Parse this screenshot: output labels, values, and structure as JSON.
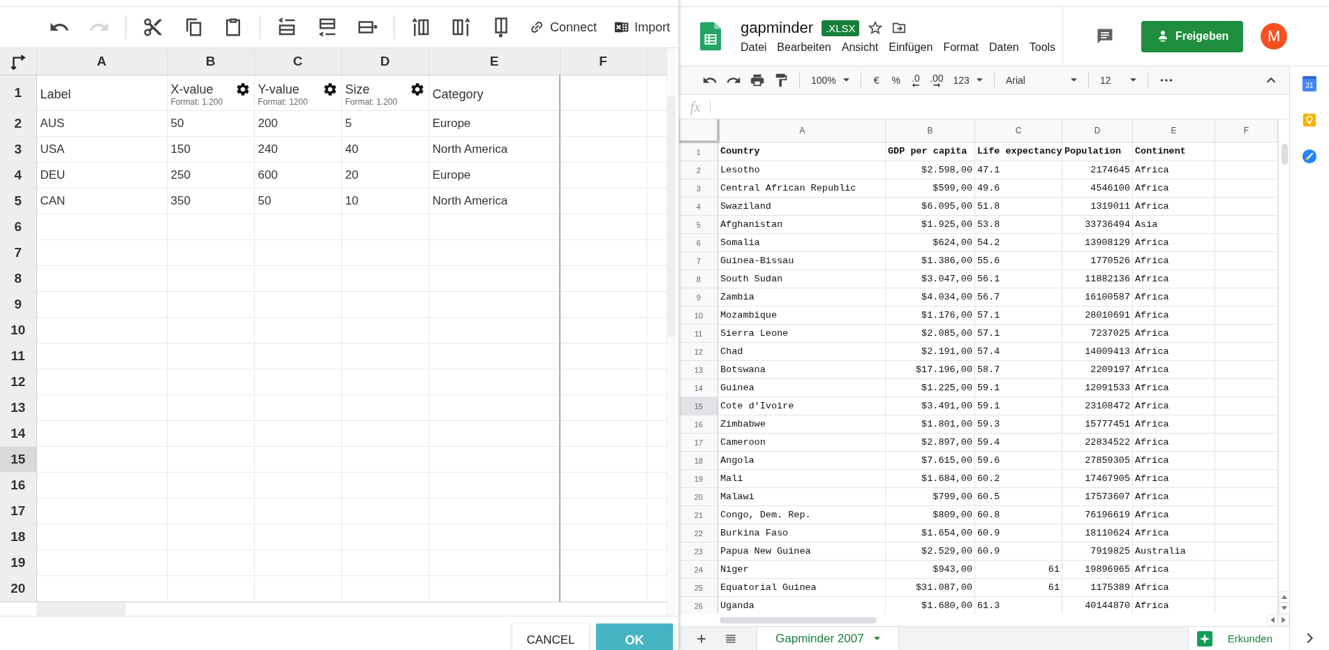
{
  "editor": {
    "toolbar": [
      {
        "kind": "undo",
        "disabled": false
      },
      {
        "kind": "redo",
        "disabled": true
      },
      {
        "kind": "separator"
      },
      {
        "kind": "cut",
        "disabled": false
      },
      {
        "kind": "copy",
        "disabled": false
      },
      {
        "kind": "paste",
        "disabled": false
      },
      {
        "kind": "separator"
      },
      {
        "kind": "row_above",
        "disabled": false
      },
      {
        "kind": "row_below",
        "disabled": false
      },
      {
        "kind": "row_delete",
        "disabled": false
      },
      {
        "kind": "separator"
      },
      {
        "kind": "col_left",
        "disabled": false
      },
      {
        "kind": "col_right",
        "disabled": false
      },
      {
        "kind": "col_delete",
        "disabled": false
      },
      {
        "kind": "connect",
        "label": "Connect",
        "disabled": false
      },
      {
        "kind": "import",
        "label": "Import",
        "disabled": false
      }
    ],
    "columns": [
      {
        "letter": "A",
        "heading": "Label"
      },
      {
        "letter": "B",
        "heading": "X-value",
        "format": "Format: 1.200"
      },
      {
        "letter": "C",
        "heading": "Y-value",
        "format": "Format: 1200"
      },
      {
        "letter": "D",
        "heading": "Size",
        "format": "Format: 1.200"
      },
      {
        "letter": "E",
        "heading": "Category"
      },
      {
        "letter": "F"
      }
    ],
    "header_row": {
      "number": "1",
      "selected": false
    },
    "rows": [
      {
        "number": "2",
        "selected": false,
        "cells": [
          "AUS",
          "50",
          "200",
          "5",
          "Europe"
        ]
      },
      {
        "number": "3",
        "selected": false,
        "cells": [
          "USA",
          "150",
          "240",
          "40",
          "North America"
        ]
      },
      {
        "number": "4",
        "selected": false,
        "cells": [
          "DEU",
          "250",
          "600",
          "20",
          "Europe"
        ]
      },
      {
        "number": "5",
        "selected": false,
        "cells": [
          "CAN",
          "350",
          "50",
          "10",
          "North America"
        ]
      },
      {
        "number": "6",
        "selected": false
      },
      {
        "number": "7",
        "selected": false
      },
      {
        "number": "8",
        "selected": false
      },
      {
        "number": "9",
        "selected": false
      },
      {
        "number": "10",
        "selected": false
      },
      {
        "number": "11",
        "selected": false
      },
      {
        "number": "12",
        "selected": false
      },
      {
        "number": "13",
        "selected": false
      },
      {
        "number": "14",
        "selected": false
      },
      {
        "number": "15",
        "selected": true
      },
      {
        "number": "16",
        "selected": false
      },
      {
        "number": "17",
        "selected": false
      },
      {
        "number": "18",
        "selected": false
      },
      {
        "number": "19",
        "selected": false
      },
      {
        "number": "20",
        "selected": false
      }
    ],
    "buttons": [
      {
        "kind": "secondary",
        "label": "CANCEL"
      },
      {
        "kind": "primary",
        "label": "OK"
      }
    ]
  },
  "sheets": {
    "title": "gapminder",
    "badge": ".XLSX",
    "menu": [
      "Datei",
      "Bearbeiten",
      "Ansicht",
      "Einfügen",
      "Format",
      "Daten",
      "Tools"
    ],
    "share_button": "Freigeben",
    "avatar": "M",
    "toolbar": [
      {
        "kind": "undo"
      },
      {
        "kind": "redo"
      },
      {
        "kind": "print"
      },
      {
        "kind": "paint"
      },
      {
        "kind": "separator"
      },
      {
        "kind": "dropdown",
        "label": "100%"
      },
      {
        "kind": "separator"
      },
      {
        "kind": "text",
        "label": "€"
      },
      {
        "kind": "text",
        "label": "%"
      },
      {
        "kind": "dec_less",
        "label": ".0"
      },
      {
        "kind": "dec_more",
        "label": ".00"
      },
      {
        "kind": "dropdown",
        "label": "123"
      },
      {
        "kind": "separator"
      },
      {
        "kind": "font",
        "label": "Arial"
      },
      {
        "kind": "separator"
      },
      {
        "kind": "font_size",
        "label": "12"
      },
      {
        "kind": "separator"
      },
      {
        "kind": "more"
      }
    ],
    "formula_label": "fx",
    "columns": [
      {
        "letter": "A",
        "right_aligned": false
      },
      {
        "letter": "B",
        "right_aligned": true
      },
      {
        "letter": "C",
        "right_aligned": false
      },
      {
        "letter": "D",
        "right_aligned": true
      },
      {
        "letter": "E",
        "right_aligned": false
      },
      {
        "letter": "F"
      }
    ],
    "header_row": {
      "number": "1",
      "selected": false,
      "cells": [
        "Country",
        "GDP per capita",
        "Life expectancy",
        "Population",
        "Continent"
      ]
    },
    "rows": [
      {
        "number": "2",
        "selected": false,
        "cells": [
          "Lesotho",
          "$2.598,00",
          "47.1",
          "2174645",
          "Africa"
        ]
      },
      {
        "number": "3",
        "selected": false,
        "cells": [
          "Central African Republic",
          "$599,00",
          "49.6",
          "4546100",
          "Africa"
        ]
      },
      {
        "number": "4",
        "selected": false,
        "cells": [
          "Swaziland",
          "$6.095,00",
          "51.8",
          "1319011",
          "Africa"
        ]
      },
      {
        "number": "5",
        "selected": false,
        "cells": [
          "Afghanistan",
          "$1.925,00",
          "53.8",
          "33736494",
          "Asia"
        ]
      },
      {
        "number": "6",
        "selected": false,
        "cells": [
          "Somalia",
          "$624,00",
          "54.2",
          "13908129",
          "Africa"
        ]
      },
      {
        "number": "7",
        "selected": false,
        "cells": [
          "Guinea-Bissau",
          "$1.386,00",
          "55.6",
          "1770526",
          "Africa"
        ]
      },
      {
        "number": "8",
        "selected": false,
        "cells": [
          "South Sudan",
          "$3.047,00",
          "56.1",
          "11882136",
          "Africa"
        ]
      },
      {
        "number": "9",
        "selected": false,
        "cells": [
          "Zambia",
          "$4.034,00",
          "56.7",
          "16100587",
          "Africa"
        ]
      },
      {
        "number": "10",
        "selected": false,
        "cells": [
          "Mozambique",
          "$1.176,00",
          "57.1",
          "28010691",
          "Africa"
        ]
      },
      {
        "number": "11",
        "selected": false,
        "cells": [
          "Sierra Leone",
          "$2.085,00",
          "57.1",
          "7237025",
          "Africa"
        ]
      },
      {
        "number": "12",
        "selected": false,
        "cells": [
          "Chad",
          "$2.191,00",
          "57.4",
          "14009413",
          "Africa"
        ]
      },
      {
        "number": "13",
        "selected": false,
        "cells": [
          "Botswana",
          "$17.196,00",
          "58.7",
          "2209197",
          "Africa"
        ]
      },
      {
        "number": "14",
        "selected": false,
        "cells": [
          "Guinea",
          "$1.225,00",
          "59.1",
          "12091533",
          "Africa"
        ]
      },
      {
        "number": "15",
        "selected": true,
        "cells": [
          "Cote d'Ivoire",
          "$3.491,00",
          "59.1",
          "23108472",
          "Africa"
        ]
      },
      {
        "number": "16",
        "selected": false,
        "cells": [
          "Zimbabwe",
          "$1.801,00",
          "59.3",
          "15777451",
          "Africa"
        ]
      },
      {
        "number": "17",
        "selected": false,
        "cells": [
          "Cameroon",
          "$2.897,00",
          "59.4",
          "22834522",
          "Africa"
        ]
      },
      {
        "number": "18",
        "selected": false,
        "cells": [
          "Angola",
          "$7.615,00",
          "59.6",
          "27859305",
          "Africa"
        ]
      },
      {
        "number": "19",
        "selected": false,
        "cells": [
          "Mali",
          "$1.684,00",
          "60.2",
          "17467905",
          "Africa"
        ]
      },
      {
        "number": "20",
        "selected": false,
        "cells": [
          "Malawi",
          "$799,00",
          "60.5",
          "17573607",
          "Africa"
        ]
      },
      {
        "number": "21",
        "selected": false,
        "cells": [
          "Congo, Dem. Rep.",
          "$809,00",
          "60.8",
          "76196619",
          "Africa"
        ]
      },
      {
        "number": "22",
        "selected": false,
        "cells": [
          "Burkina Faso",
          "$1.654,00",
          "60.9",
          "18110624",
          "Africa"
        ]
      },
      {
        "number": "23",
        "selected": false,
        "cells": [
          "Papua New Guinea",
          "$2.529,00",
          "60.9",
          "7919825",
          "Australia"
        ]
      },
      {
        "number": "24",
        "selected": false,
        "cells": [
          "Niger",
          "$943,00",
          {
            "text": "61",
            "right_aligned": true
          },
          "19896965",
          "Africa"
        ]
      },
      {
        "number": "25",
        "selected": false,
        "cells": [
          "Equatorial Guinea",
          "$31.087,00",
          {
            "text": "61",
            "right_aligned": true
          },
          "1175389",
          "Africa"
        ]
      },
      {
        "number": "26",
        "selected": false,
        "cells": [
          "Uganda",
          "$1.680,00",
          "61.3",
          "40144870",
          "Africa"
        ]
      }
    ],
    "sheet_tabs": [
      {
        "label": "Gapminder 2007",
        "selected": true
      }
    ],
    "explore_button": "Erkunden",
    "calendar_day": "31"
  }
}
